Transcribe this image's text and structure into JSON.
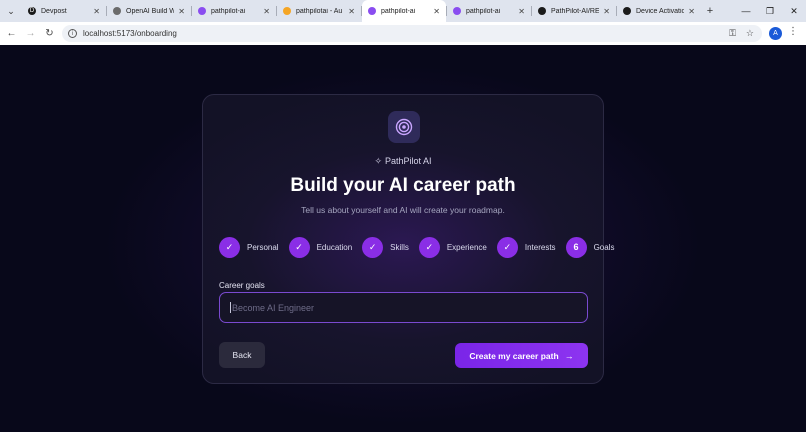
{
  "browser": {
    "tabs": [
      {
        "title": "Devpost",
        "icon": "devpost-icon",
        "color": "#1b1b1b",
        "glyph": "D",
        "active": false
      },
      {
        "title": "OpenAI Build We",
        "icon": "openai-icon",
        "color": "#6b6b6b",
        "glyph": "",
        "active": false
      },
      {
        "title": "pathpilot-ai",
        "icon": "vite-icon",
        "color": "#8a4df0",
        "glyph": "",
        "active": false
      },
      {
        "title": "pathpilotai - Au",
        "icon": "firebase-icon",
        "color": "#f5a524",
        "glyph": "",
        "active": false
      },
      {
        "title": "pathpilot-ai",
        "icon": "vite-icon",
        "color": "#8a4df0",
        "glyph": "",
        "active": true
      },
      {
        "title": "pathpilot-ai",
        "icon": "vite-icon",
        "color": "#8a4df0",
        "glyph": "",
        "active": false
      },
      {
        "title": "PathPilot-AI/RE",
        "icon": "github-icon",
        "color": "#1b1b1b",
        "glyph": "",
        "active": false
      },
      {
        "title": "Device Activatio",
        "icon": "github-icon",
        "color": "#1b1b1b",
        "glyph": "",
        "active": false
      }
    ],
    "url": "localhost:5173/onboarding",
    "profile_initial": "A"
  },
  "card": {
    "brand": "PathPilot AI",
    "title": "Build your AI career path",
    "subtitle": "Tell us about yourself and AI will create your roadmap.",
    "steps": [
      {
        "label": "Personal",
        "status": "done",
        "marker": "✓"
      },
      {
        "label": "Education",
        "status": "done",
        "marker": "✓"
      },
      {
        "label": "Skills",
        "status": "done",
        "marker": "✓"
      },
      {
        "label": "Experience",
        "status": "done",
        "marker": "✓"
      },
      {
        "label": "Interests",
        "status": "done",
        "marker": "✓"
      },
      {
        "label": "Goals",
        "status": "current",
        "marker": "6"
      }
    ],
    "field_label": "Career goals",
    "field_placeholder": "Become AI Engineer",
    "field_value": "",
    "back_label": "Back",
    "create_label": "Create my career path",
    "accent_color": "#8a2ee6"
  }
}
